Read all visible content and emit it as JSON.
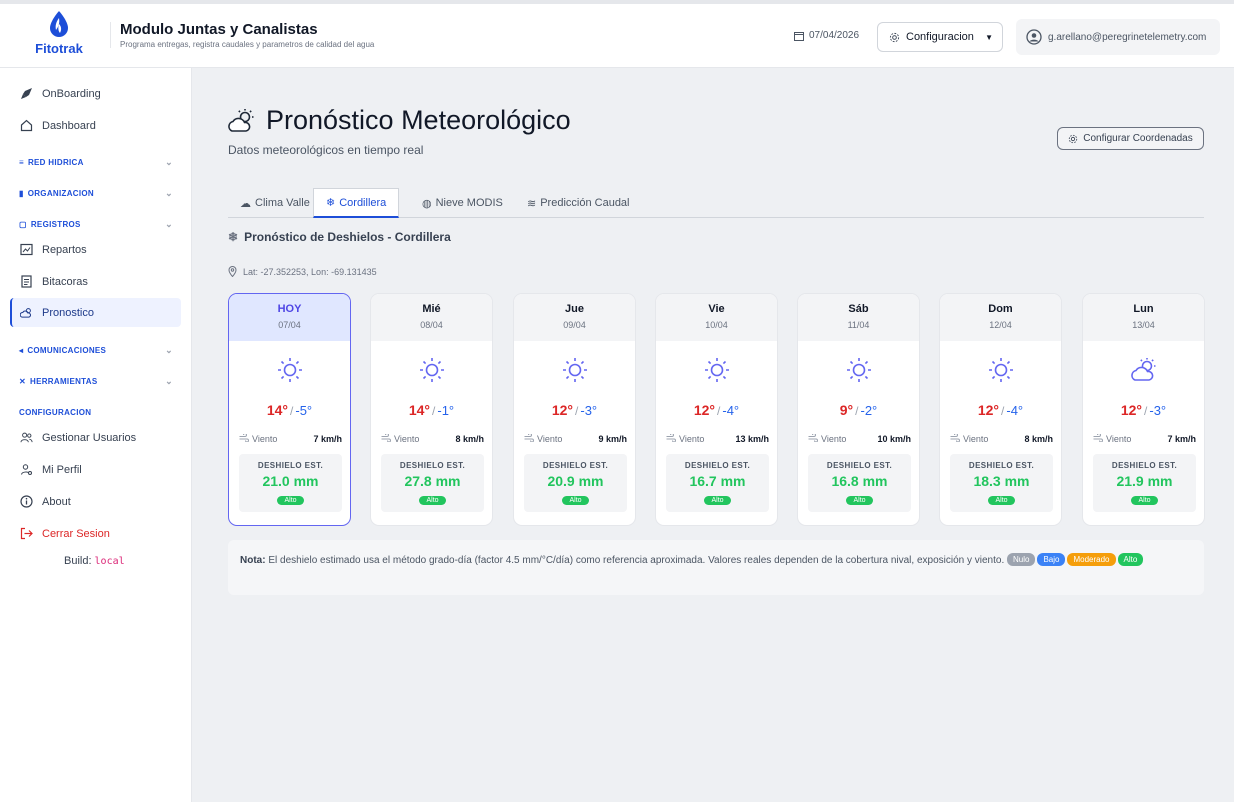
{
  "header": {
    "logo_text": "Fitotrak",
    "app_title": "Modulo Juntas y Canalistas",
    "app_subtitle": "Programa entregas, registra caudales y parametros de calidad del agua",
    "date": "07/04/2026",
    "config_label": "Configuracion",
    "user_email": "g.arellano@peregrinetelemetry.com"
  },
  "sidebar": {
    "onboarding": "OnBoarding",
    "dashboard": "Dashboard",
    "red_hidrica": "RED HIDRICA",
    "organizacion": "ORGANIZACION",
    "registros": "REGISTROS",
    "repartos": "Repartos",
    "bitacoras": "Bitacoras",
    "pronostico": "Pronostico",
    "comunicaciones": "COMUNICACIONES",
    "herramientas": "HERRAMIENTAS",
    "configuracion": "CONFIGURACION",
    "gestionar_usuarios": "Gestionar Usuarios",
    "mi_perfil": "Mi Perfil",
    "about": "About",
    "cerrar_sesion": "Cerrar Sesion",
    "build_label": "Build:",
    "build_value": "local"
  },
  "main": {
    "title": "Pronóstico Meteorológico",
    "subtitle": "Datos meteorológicos en tiempo real",
    "coords_button": "Configurar Coordenadas",
    "tabs": [
      "Clima Valle",
      "Cordillera",
      "Nieve MODIS",
      "Predicción Caudal"
    ],
    "active_tab": "Cordillera",
    "section_title": "Pronóstico de Deshielos - Cordillera",
    "latlon": "Lat: -27.352253, Lon: -69.131435",
    "wind_label": "Viento",
    "melt_label": "DESHIELO EST.",
    "days": [
      {
        "day": "HOY",
        "date": "07/04",
        "icon": "sun-icon",
        "tmax": "14°",
        "tmin": "-5°",
        "wind": "7 km/h",
        "melt": "21.0 mm",
        "level": "Alto"
      },
      {
        "day": "Mié",
        "date": "08/04",
        "icon": "sun-icon",
        "tmax": "14°",
        "tmin": "-1°",
        "wind": "8 km/h",
        "melt": "27.8 mm",
        "level": "Alto"
      },
      {
        "day": "Jue",
        "date": "09/04",
        "icon": "sun-icon",
        "tmax": "12°",
        "tmin": "-3°",
        "wind": "9 km/h",
        "melt": "20.9 mm",
        "level": "Alto"
      },
      {
        "day": "Vie",
        "date": "10/04",
        "icon": "sun-icon",
        "tmax": "12°",
        "tmin": "-4°",
        "wind": "13 km/h",
        "melt": "16.7 mm",
        "level": "Alto"
      },
      {
        "day": "Sáb",
        "date": "11/04",
        "icon": "sun-icon",
        "tmax": "9°",
        "tmin": "-2°",
        "wind": "10 km/h",
        "melt": "16.8 mm",
        "level": "Alto"
      },
      {
        "day": "Dom",
        "date": "12/04",
        "icon": "sun-icon",
        "tmax": "12°",
        "tmin": "-4°",
        "wind": "8 km/h",
        "melt": "18.3 mm",
        "level": "Alto"
      },
      {
        "day": "Lun",
        "date": "13/04",
        "icon": "partly-cloudy-icon",
        "tmax": "12°",
        "tmin": "-3°",
        "wind": "7 km/h",
        "melt": "21.9 mm",
        "level": "Alto"
      }
    ],
    "note_label": "Nota:",
    "note_text": "El deshielo estimado usa el método grado-día (factor 4.5 mm/°C/día) como referencia aproximada. Valores reales dependen de la cobertura nival, exposición y viento.",
    "levels": [
      {
        "label": "Nulo",
        "color": "#9ca3af"
      },
      {
        "label": "Bajo",
        "color": "#3b82f6"
      },
      {
        "label": "Moderado",
        "color": "#f59e0b"
      },
      {
        "label": "Alto",
        "color": "#22c55e"
      }
    ]
  }
}
